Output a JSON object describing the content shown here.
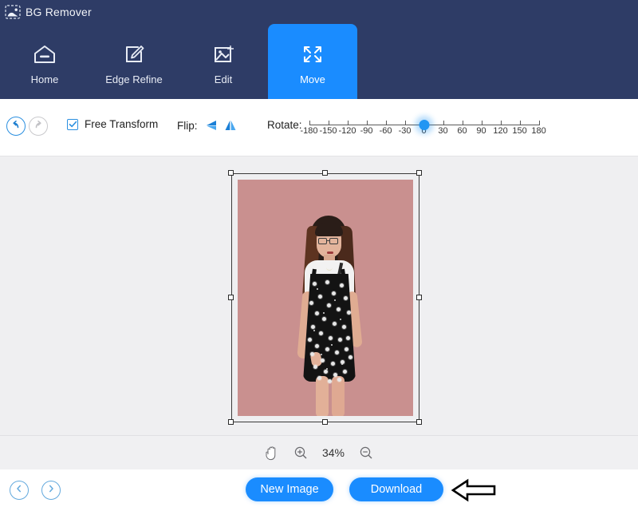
{
  "app": {
    "title": "BG Remover",
    "logo_icon": "image-crop-icon",
    "header_color": "#2e3c66",
    "accent_color": "#1a8cff",
    "canvas_bg": "#efeff1"
  },
  "nav": {
    "tabs": [
      {
        "label": "Home",
        "icon": "home-minus-icon",
        "active": false
      },
      {
        "label": "Edge Refine",
        "icon": "pen-square-icon",
        "active": false
      },
      {
        "label": "Edit",
        "icon": "image-edit-icon",
        "active": false
      },
      {
        "label": "Move",
        "icon": "move-arrows-icon",
        "active": true
      }
    ]
  },
  "toolbar": {
    "undo_icon": "undo-arrow-icon",
    "redo_icon": "redo-arrow-icon",
    "undo_enabled": "true",
    "redo_enabled": "false",
    "free_transform_label": "Free Transform",
    "free_transform_checked": "true",
    "flip_label": "Flip:",
    "flip_horizontal_icon": "flip-horizontal-icon",
    "flip_vertical_icon": "flip-vertical-icon",
    "rotate_label": "Rotate:",
    "rotate_value": 0,
    "rotate_min": -180,
    "rotate_max": 180,
    "rotate_step": 30,
    "rotate_ticks": [
      "-180",
      "-150",
      "-120",
      "-90",
      "-60",
      "-30",
      "0",
      "30",
      "60",
      "90",
      "120",
      "150",
      "180"
    ]
  },
  "canvas": {
    "image_alt": "woman-in-black-floral-dress",
    "image_bg_color": "#c9908f",
    "selection": {
      "handles": 8,
      "handle_color": "#ffffff",
      "frame_color": "#3a3a3a"
    }
  },
  "zoombar": {
    "hand_icon": "hand-tool-icon",
    "zoom_in_icon": "zoom-in-icon",
    "zoom_out_icon": "zoom-out-icon",
    "zoom_level": "34%"
  },
  "footer": {
    "prev_icon": "chevron-left-icon",
    "next_icon": "chevron-right-icon",
    "new_image_label": "New Image",
    "download_label": "Download",
    "annotation_icon": "left-arrow-annotation-icon"
  }
}
